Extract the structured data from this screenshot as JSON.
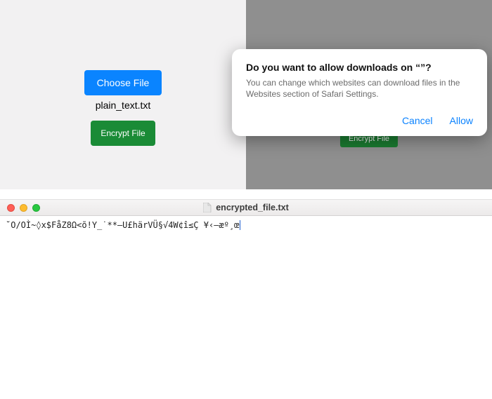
{
  "left": {
    "choose_label": "Choose File",
    "filename": "plain_text.txt",
    "encrypt_label": "Encrypt File"
  },
  "right": {
    "bg_encrypt_label": "Encrypt File"
  },
  "dialog": {
    "title": "Do you want to allow downloads on “”?",
    "body": "You can change which websites can download files in the Websites section of Safari Settings.",
    "cancel": "Cancel",
    "allow": "Allow"
  },
  "textedit": {
    "title": "encrypted_file.txt",
    "content": "˘O/OÌ~◊x$FåZ8Ω<õ!Y_˙**—U£härVÜ§√4W¢î≤Ç ¥‹—æº¸œ"
  }
}
